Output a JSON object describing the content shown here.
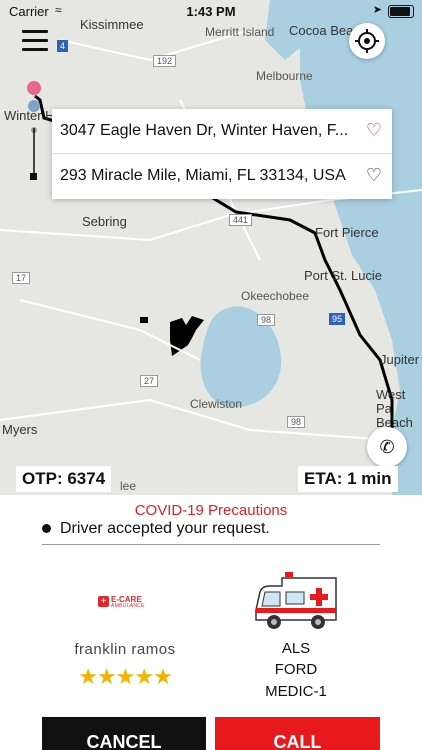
{
  "status_bar": {
    "carrier": "Carrier",
    "time": "1:43 PM"
  },
  "map": {
    "labels": {
      "kissimmee": "Kissimmee",
      "merritt_island": "Merritt Island",
      "cocoa_beach": "Cocoa Beach",
      "melbourne": "Melbourne",
      "winter_haven": "Winter Ha",
      "sebring": "Sebring",
      "fort_pierce": "Fort Pierce",
      "port_st_lucie": "Port St. Lucie",
      "okeechobee": "Okeechobee",
      "jupiter": "Jupiter",
      "west_palm_beach": "West Pa Beach",
      "clewiston": "Clewiston",
      "myers": "Myers",
      "lee": "lee"
    },
    "shields": {
      "i4": "4",
      "us192": "192",
      "us441": "441",
      "us17": "17",
      "us98a": "98",
      "i95": "95",
      "us27": "27",
      "us98b": "98"
    }
  },
  "route": {
    "pickup": "3047 Eagle Haven Dr, Winter Haven, F...",
    "dropoff": "293 Miracle Mile, Miami, FL 33134, USA"
  },
  "otp": "OTP: 6374",
  "eta": "ETA: 1 min",
  "covid": "COVID-19 Precautions",
  "trip_status": "Driver accepted your request.",
  "provider": {
    "logo_main": "E-CARE",
    "logo_sub": "AMBULANCE"
  },
  "driver": {
    "name": "franklin  ramos",
    "rating": 5,
    "stars": "★★★★★"
  },
  "vehicle": {
    "line1": "ALS",
    "line2": "FORD",
    "line3": "MEDIC-1"
  },
  "buttons": {
    "cancel": "CANCEL",
    "call": "CALL"
  },
  "colors": {
    "accent": "#e8191c",
    "heart_active": "#e0344b",
    "star": "#f5b301",
    "covid_text": "#e02020"
  }
}
